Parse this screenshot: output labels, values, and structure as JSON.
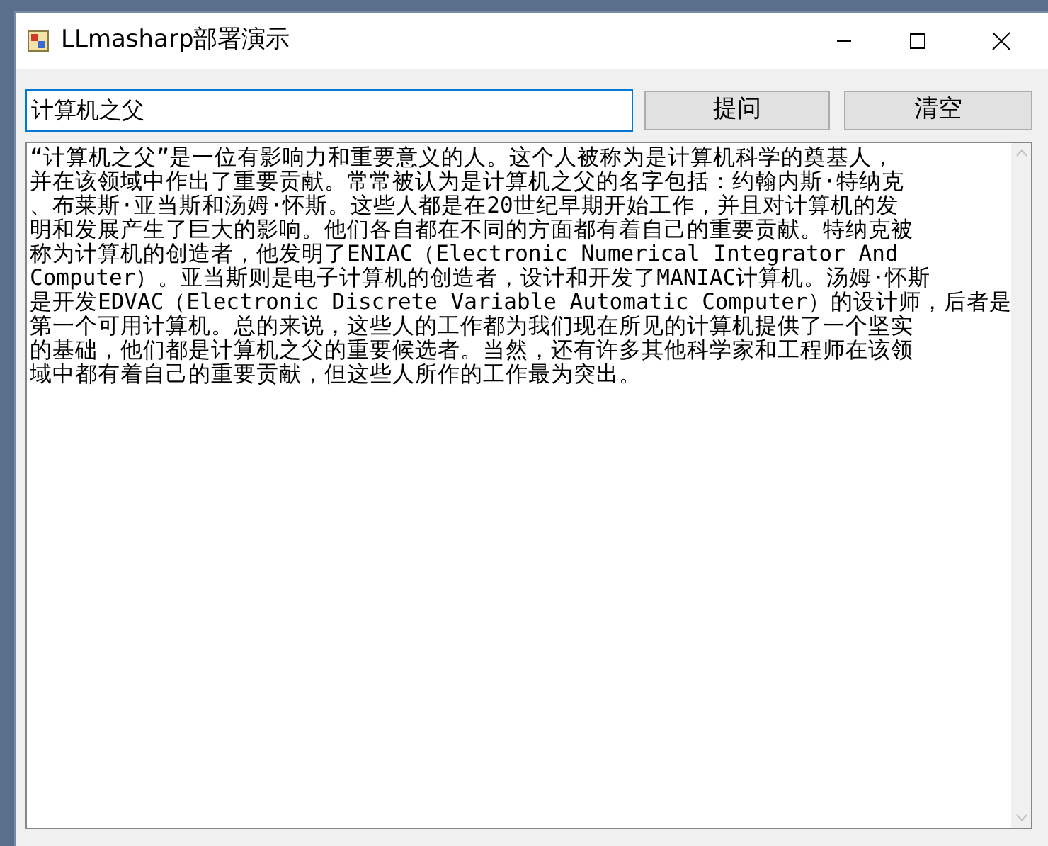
{
  "window": {
    "title": "LLmasharp部署演示"
  },
  "question_field": {
    "value": "计算机之父"
  },
  "buttons": [
    {
      "label": "提问"
    },
    {
      "label": "清空"
    }
  ],
  "answer": {
    "lines": [
      "“计算机之父”是一位有影响力和重要意义的人。这个人被称为是计算机科学的奠基人，",
      "并在该领域中作出了重要贡献。常常被认为是计算机之父的名字包括：约翰内斯·特纳克",
      "、布莱斯·亚当斯和汤姆·怀斯。这些人都是在20世纪早期开始工作，并且对计算机的发",
      "明和发展产生了巨大的影响。他们各自都在不同的方面都有着自己的重要贡献。特纳克被",
      "称为计算机的创造者，他发明了ENIAC（Electronic Numerical Integrator And",
      "Computer）。亚当斯则是电子计算机的创造者，设计和开发了MANIAC计算机。汤姆·怀斯",
      "是开发EDVAC（Electronic Discrete Variable Automatic Computer）的设计师，后者是",
      "第一个可用计算机。总的来说，这些人的工作都为我们现在所见的计算机提供了一个坚实",
      "的基础，他们都是计算机之父的重要候选者。当然，还有许多其他科学家和工程师在该领",
      "域中都有着自己的重要贡献，但这些人所作的工作最为突出。"
    ]
  }
}
